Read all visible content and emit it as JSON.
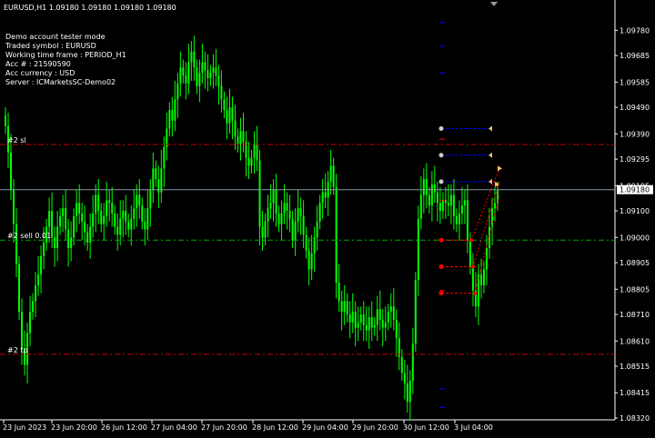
{
  "header": {
    "text": "EURUSD,H1  1.09180 1.09180 1.09180 1.09180"
  },
  "info_panel": {
    "lines": [
      "Demo account tester mode",
      "Traded symbol : EURUSD",
      "Working time frame : PERIOD_H1",
      "Acc # : 21590590",
      "Acc currency : USD",
      "Server : ICMarketsSC-Demo02"
    ]
  },
  "colors": {
    "background": "#000000",
    "candle": "#00ff00",
    "grid_text": "#ffffff",
    "sl_line": "#cc0000",
    "entry_line": "#00aa00",
    "tp_line": "#cc0000",
    "bid_line": "#8899aa",
    "price_tag_bg": "#ffffff",
    "blue_dash": "#0000ff",
    "red_marker": "#ff0000",
    "gold_marker": "#f0c060"
  },
  "chart_data": {
    "type": "candlestick",
    "symbol": "EURUSD",
    "timeframe": "H1",
    "ylim": [
      1.0832,
      1.0986
    ],
    "y_ticks": [
      "1.09780",
      "1.09685",
      "1.09585",
      "1.09490",
      "1.09390",
      "1.09295",
      "1.09195",
      "1.09100",
      "1.09000",
      "1.08905",
      "1.08805",
      "1.08710",
      "1.08610",
      "1.08515",
      "1.08415",
      "1.08320"
    ],
    "y_tick_values": [
      1.0978,
      1.09685,
      1.09585,
      1.0949,
      1.0939,
      1.09295,
      1.09195,
      1.091,
      1.09,
      1.08905,
      1.08805,
      1.0871,
      1.0861,
      1.08515,
      1.08415,
      1.0832
    ],
    "x_ticks": [
      "23 Jun 2023",
      "23 Jun 20:00",
      "26 Jun 12:00",
      "27 Jun 04:00",
      "27 Jun 20:00",
      "28 Jun 12:00",
      "29 Jun 04:00",
      "29 Jun 20:00",
      "30 Jun 12:00",
      "3 Jul 04:00"
    ],
    "current_price": 1.0918,
    "current_price_label": "1.09180",
    "lines": [
      {
        "label": "#2 sl",
        "price": 1.0935,
        "style": "sl"
      },
      {
        "label": "#2 sell 0.01",
        "price": 1.0899,
        "style": "entry"
      },
      {
        "label": "#2 tp",
        "price": 1.0856,
        "style": "tp"
      }
    ],
    "closes": [
      1.0942,
      1.0932,
      1.0918,
      1.0905,
      1.089,
      1.0872,
      1.0858,
      1.0852,
      1.0864,
      1.0872,
      1.0876,
      1.0882,
      1.0886,
      1.0893,
      1.0898,
      1.0904,
      1.091,
      1.09,
      1.0896,
      1.0904,
      1.0908,
      1.0911,
      1.0903,
      1.0896,
      1.09,
      1.0908,
      1.0913,
      1.0909,
      1.0906,
      1.0902,
      1.0898,
      1.0904,
      1.0909,
      1.0916,
      1.091,
      1.0905,
      1.0908,
      1.0914,
      1.0913,
      1.0909,
      1.0904,
      1.0901,
      1.0907,
      1.091,
      1.0906,
      1.0903,
      1.0907,
      1.0911,
      1.0916,
      1.0912,
      1.0906,
      1.0903,
      1.0911,
      1.0918,
      1.0926,
      1.0922,
      1.0917,
      1.0926,
      1.0934,
      1.0941,
      1.0948,
      1.0944,
      1.0952,
      1.0958,
      1.0964,
      1.0961,
      1.0958,
      1.0966,
      1.097,
      1.0964,
      1.0957,
      1.0962,
      1.0966,
      1.0963,
      1.096,
      1.0962,
      1.0964,
      1.0961,
      1.0957,
      1.0952,
      1.0948,
      1.0943,
      1.0949,
      1.0944,
      1.0938,
      1.0935,
      1.094,
      1.0936,
      1.093,
      1.0927,
      1.093,
      1.0935,
      1.0929,
      1.0904,
      1.09,
      1.0906,
      1.0911,
      1.0913,
      1.0918,
      1.0909,
      1.0905,
      1.0909,
      1.0913,
      1.091,
      1.0907,
      1.0899,
      1.0906,
      1.0911,
      1.0908,
      1.0901,
      1.0895,
      1.0888,
      1.0894,
      1.09,
      1.0906,
      1.0913,
      1.0917,
      1.0915,
      1.0921,
      1.0927,
      1.0919,
      1.0883,
      1.0876,
      1.0872,
      1.0876,
      1.0871,
      1.0868,
      1.0872,
      1.0866,
      1.0868,
      1.0871,
      1.0867,
      1.0865,
      1.087,
      1.0866,
      1.0867,
      1.0873,
      1.0869,
      1.0866,
      1.0868,
      1.0872,
      1.0874,
      1.0869,
      1.0862,
      1.0855,
      1.0849,
      1.0845,
      1.0838,
      1.0846,
      1.086,
      1.0884,
      1.0907,
      1.0916,
      1.0922,
      1.0916,
      1.0912,
      1.092,
      1.0917,
      1.0913,
      1.091,
      1.0914,
      1.0913,
      1.0912,
      1.0916,
      1.0908,
      1.0905,
      1.0909,
      1.0912,
      1.0914,
      1.0899,
      1.0889,
      1.088,
      1.0874,
      1.0886,
      1.0882,
      1.0888,
      1.0896,
      1.0904,
      1.0911,
      1.0913,
      1.0918
    ]
  }
}
